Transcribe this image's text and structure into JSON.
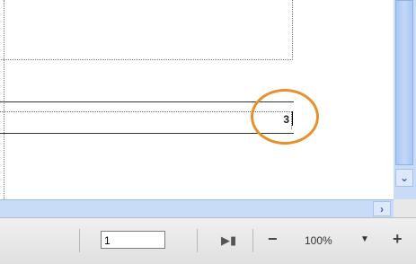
{
  "document": {
    "field_value": "3"
  },
  "scrollbars": {
    "down_arrow_icon": "chevron-down-icon",
    "right_arrow_icon": "chevron-right-icon"
  },
  "statusbar": {
    "page_number": "1",
    "zoom_level": "100%",
    "zoom_minus": "−",
    "zoom_plus": "+"
  },
  "colors": {
    "highlight": "#e8902a",
    "scrollbar": "#c8dcf7"
  }
}
